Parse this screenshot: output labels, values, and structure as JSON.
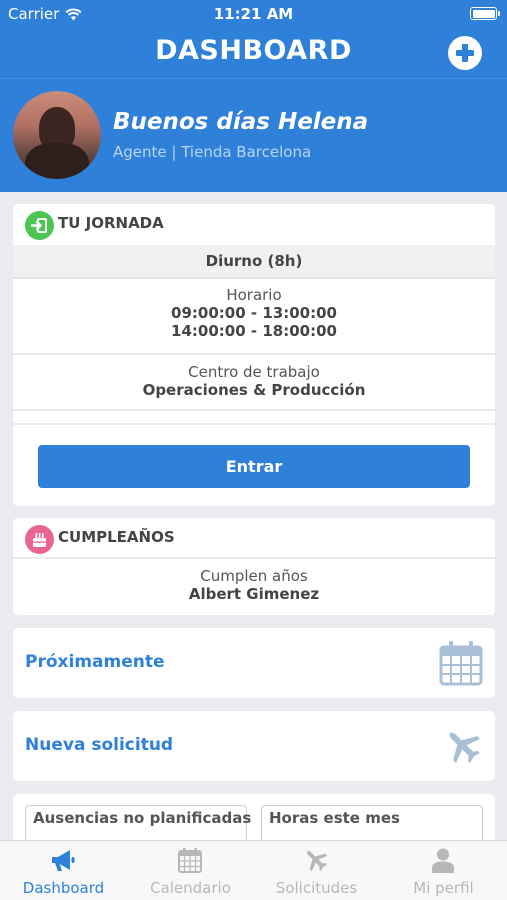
{
  "status_bar": {
    "carrier": "Carrier",
    "time": "11:21 AM"
  },
  "nav": {
    "title": "DASHBOARD",
    "add_icon": "plus-circle-icon"
  },
  "header": {
    "greeting": "Buenos días Helena",
    "subtitle": "Agente | Tienda Barcelona"
  },
  "jornada": {
    "title": "TU JORNADA",
    "shift": "Diurno (8h)",
    "schedule_label": "Horario",
    "schedule": [
      "09:00:00 - 13:00:00",
      "14:00:00 - 18:00:00"
    ],
    "workplace_label": "Centro de trabajo",
    "workplace": "Operaciones & Producción",
    "enter_button": "Entrar",
    "icon_color": "#4cc552"
  },
  "birthdays": {
    "title": "CUMPLEAÑOS",
    "label": "Cumplen años",
    "name": "Albert Gimenez",
    "icon_color": "#e9658f"
  },
  "links": [
    {
      "label": "Próximamente",
      "icon": "calendar-icon"
    },
    {
      "label": "Nueva solicitud",
      "icon": "airplane-icon"
    }
  ],
  "stats": [
    {
      "label": "Ausencias no planificadas"
    },
    {
      "label": "Horas este mes"
    }
  ],
  "tabbar": [
    {
      "label": "Dashboard",
      "icon": "megaphone-icon",
      "active": true
    },
    {
      "label": "Calendario",
      "icon": "calendar-icon",
      "active": false
    },
    {
      "label": "Solicitudes",
      "icon": "airplane-icon",
      "active": false
    },
    {
      "label": "Mi perfil",
      "icon": "user-icon",
      "active": false
    }
  ],
  "colors": {
    "primary": "#2f80d8",
    "background": "#e9ebee",
    "inactive": "#b7b7b7"
  }
}
